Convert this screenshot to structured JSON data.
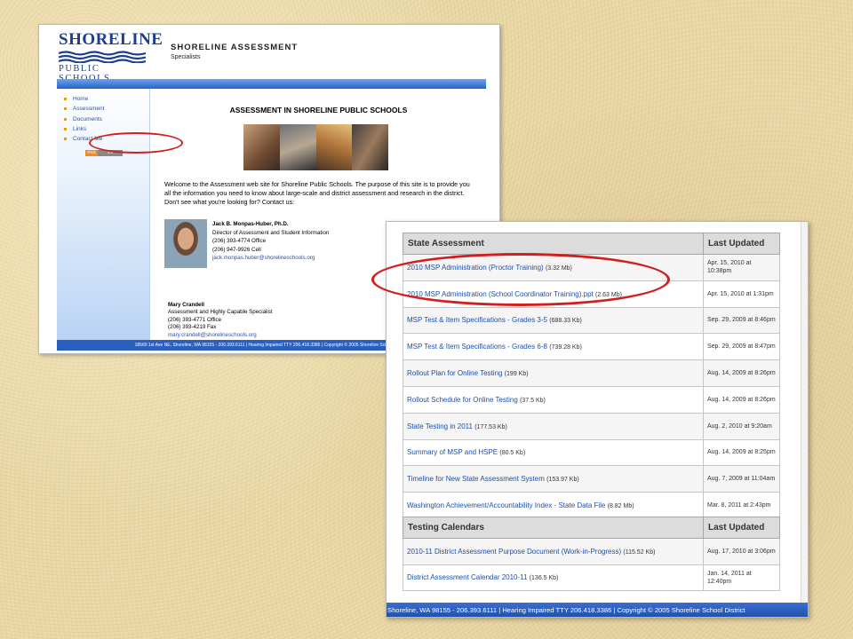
{
  "home": {
    "logo_top": "SHORELINE",
    "logo_bottom": "PUBLIC SCHOOLS",
    "site_title": "SHORELINE ASSESSMENT",
    "site_subtitle": "Specialists",
    "nav": [
      "Home",
      "Assessment",
      "Documents",
      "Links",
      "Contact Me"
    ],
    "badge": [
      "RSS",
      "2.0"
    ],
    "heading": "ASSESSMENT IN SHORELINE PUBLIC SCHOOLS",
    "welcome": "Welcome to the Assessment web site for Shoreline Public Schools.  The purpose of this site is to provide you all the information you need to know about large-scale and district assessment and research in the district.  Don't see what you're looking for?  Contact us:",
    "contact1": {
      "name": "Jack B. Monpas-Huber, Ph.D.",
      "title": "Director of Assessment and Student Information",
      "office": "(206) 393-4774 Office",
      "cell": "(206) 947-9926 Cell",
      "email": "jack.monpas.huber@shorelineschools.org"
    },
    "contact2": {
      "name": "Mary Crandell",
      "title": "Assessment and Highly Capable Specialist",
      "office": "(206) 393-4771 Office",
      "fax": "(206) 393-4219 Fax",
      "email": "mary.crandell@shorelineschools.org"
    },
    "footer": "18560 1st Ave NE, Shoreline, WA 98155 - 206.393.6111 | Hearing Impaired TTY 206.418.3386 | Copyright © 2005 Shoreline School District"
  },
  "docs": {
    "state": {
      "col_doc": "State Assessment",
      "col_updated": "Last Updated",
      "rows": [
        {
          "title": "2010 MSP Administration (Proctor Training)",
          "size": "(3.32 Mb)",
          "updated": "Apr. 15, 2010 at 10:38pm"
        },
        {
          "title": "2010 MSP Administration (School Coordinator Training).ppt",
          "size": "(2.63 Mb)",
          "updated": "Apr. 15, 2010 at 1:31pm"
        },
        {
          "title": "MSP Test & Item Specifications - Grades 3-5",
          "size": "(688.33 Kb)",
          "updated": "Sep. 29, 2009 at 8:46pm"
        },
        {
          "title": "MSP Test & Item Specifications - Grades 6-8",
          "size": "(739.28 Kb)",
          "updated": "Sep. 29, 2009 at 8:47pm"
        },
        {
          "title": "Rollout Plan for Online Testing",
          "size": "(199 Kb)",
          "updated": "Aug. 14, 2009 at 8:26pm"
        },
        {
          "title": "Rollout Schedule for Online Testing",
          "size": "(37.5 Kb)",
          "updated": "Aug. 14, 2009 at 8:26pm"
        },
        {
          "title": "State Testing in 2011",
          "size": "(177.53 Kb)",
          "updated": "Aug. 2, 2010 at 9:20am"
        },
        {
          "title": "Summary of MSP and HSPE",
          "size": "(80.5 Kb)",
          "updated": "Aug. 14, 2009 at 8:25pm"
        },
        {
          "title": "Timeline for New State Assessment System",
          "size": "(153.97 Kb)",
          "updated": "Aug. 7, 2009 at 11:04am"
        },
        {
          "title": "Washington Achievement/Accountability Index - State Data File",
          "size": "(8.82 Mb)",
          "updated": "Mar. 8, 2011 at 2:43pm"
        }
      ]
    },
    "calendars": {
      "col_doc": "Testing Calendars",
      "col_updated": "Last Updated",
      "rows": [
        {
          "title": "2010-11 District Assessment Purpose Document (Work-in-Progress)",
          "size": "(115.52 Kb)",
          "updated": "Aug. 17, 2010 at 3:06pm"
        },
        {
          "title": "District Assessment Calendar 2010-11",
          "size": "(136.5 Kb)",
          "updated": "Jan. 14, 2011 at 12:40pm"
        }
      ]
    },
    "footer": "Shoreline, WA 98155 - 206.393.6111 | Hearing Impaired TTY 206.418.3386 | Copyright © 2005 Shoreline School District"
  },
  "colors": {
    "highlight_ring": "#d11e1e",
    "link": "#1e4fa8",
    "brand_blue": "#1d3e8f",
    "background": "#e9d8a6"
  }
}
